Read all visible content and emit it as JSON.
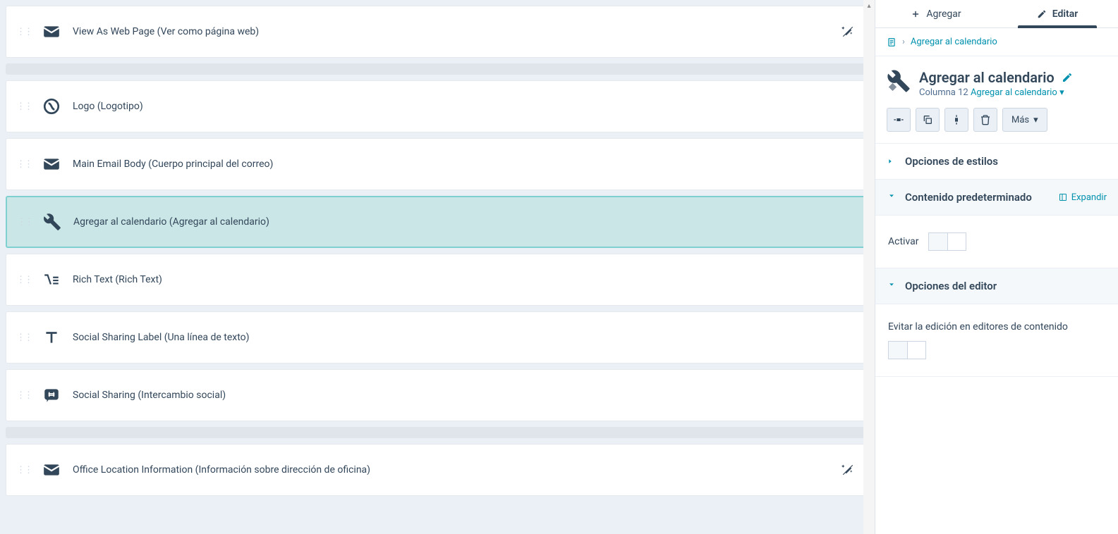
{
  "modules": [
    {
      "icon": "envelope",
      "label": "View As Web Page (Ver como página web)",
      "action": "magic-wand-off"
    },
    {
      "icon": "logo",
      "label": "Logo (Logotipo)"
    },
    {
      "icon": "envelope",
      "label": "Main Email Body (Cuerpo principal del correo)"
    },
    {
      "icon": "tools",
      "label": "Agregar al calendario (Agregar al calendario)",
      "selected": true
    },
    {
      "icon": "richtext",
      "label": "Rich Text (Rich Text)"
    },
    {
      "icon": "text-t",
      "label": "Social Sharing Label (Una línea de texto)"
    },
    {
      "icon": "hash-bubble",
      "label": "Social Sharing (Intercambio social)"
    },
    {
      "icon": "envelope",
      "label": "Office Location Information (Información sobre dirección de oficina)",
      "action": "magic-wand-off"
    }
  ],
  "gapsAfter": [
    0,
    6
  ],
  "side": {
    "tabs": {
      "add": "Agregar",
      "edit": "Editar"
    },
    "breadcrumb": {
      "current": "Agregar al calendario"
    },
    "header": {
      "title": "Agregar al calendario",
      "column_prefix": "Columna 12",
      "link": "Agregar al calendario"
    },
    "more_label": "Más",
    "sections": {
      "styles": "Opciones de estilos",
      "default_content": "Contenido predeterminado",
      "expand": "Expandir",
      "activate": "Activar",
      "editor_options": "Opciones del editor",
      "prevent_edit": "Evitar la edición en editores de contenido"
    }
  }
}
